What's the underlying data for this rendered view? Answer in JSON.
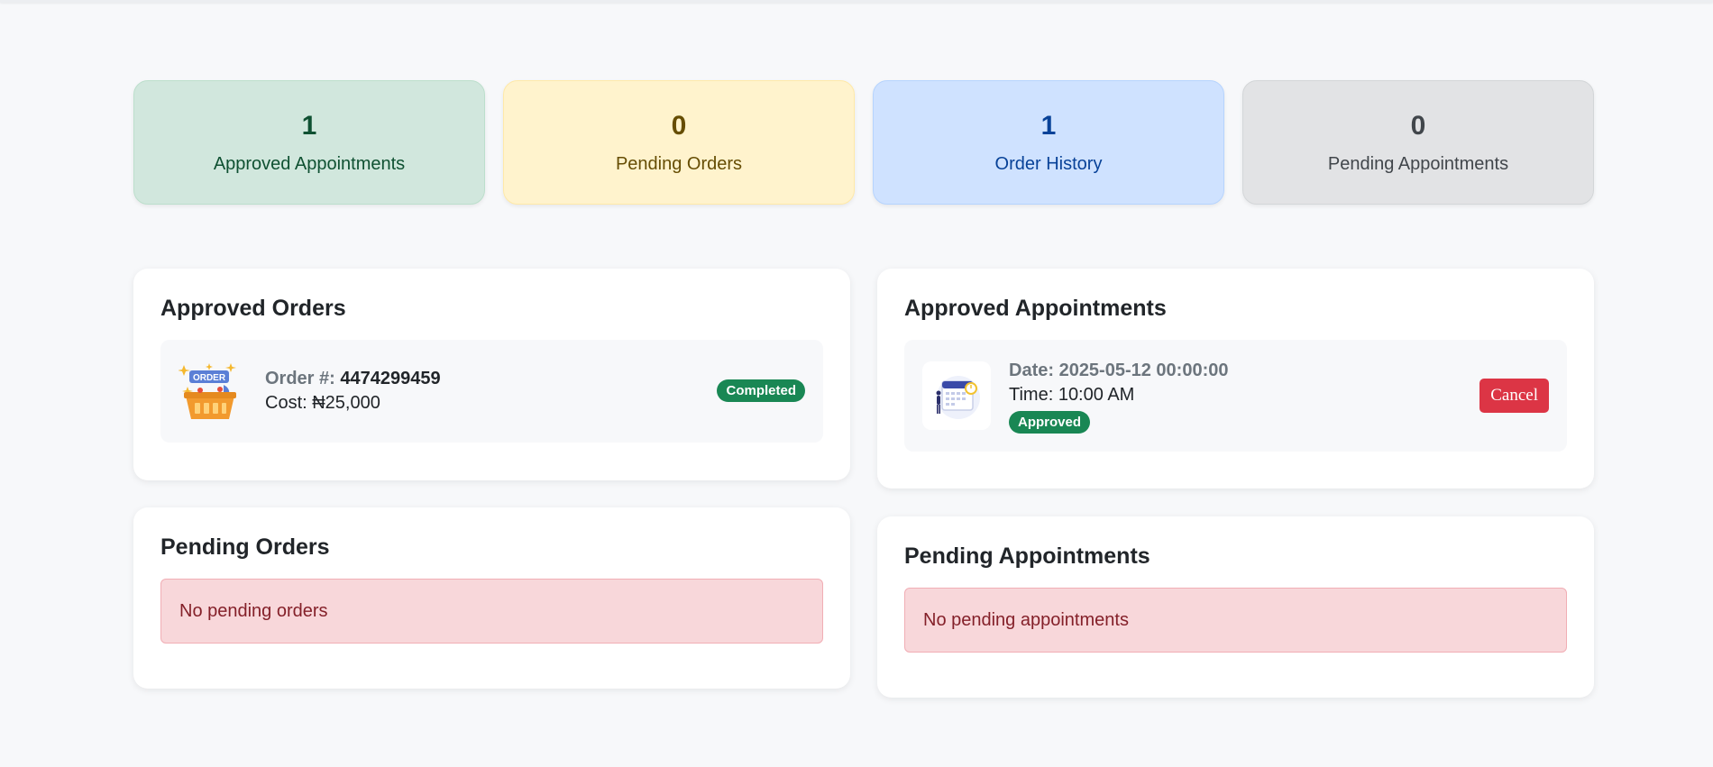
{
  "stats": [
    {
      "value": "1",
      "label": "Approved Appointments"
    },
    {
      "value": "0",
      "label": "Pending Orders"
    },
    {
      "value": "1",
      "label": "Order History"
    },
    {
      "value": "0",
      "label": "Pending Appointments"
    }
  ],
  "approved_orders": {
    "title": "Approved Orders",
    "item": {
      "image_icon": "order-basket-icon",
      "image_text": "ORDER",
      "order_label": "Order #:",
      "order_number": "4474299459",
      "cost_text": "Cost: ₦25,000",
      "status": "Completed"
    }
  },
  "pending_orders": {
    "title": "Pending Orders",
    "empty_text": "No pending orders"
  },
  "approved_appointments": {
    "title": "Approved Appointments",
    "item": {
      "image_icon": "calendar-illustration-icon",
      "date_text": "Date: 2025-05-12 00:00:00",
      "time_text": "Time: 10:00 AM",
      "status": "Approved",
      "cancel_label": "Cancel"
    }
  },
  "pending_appointments": {
    "title": "Pending Appointments",
    "empty_text": "No pending appointments"
  },
  "colors": {
    "success": "#198754",
    "danger": "#dc3545",
    "alert_bg": "#f8d7da"
  }
}
